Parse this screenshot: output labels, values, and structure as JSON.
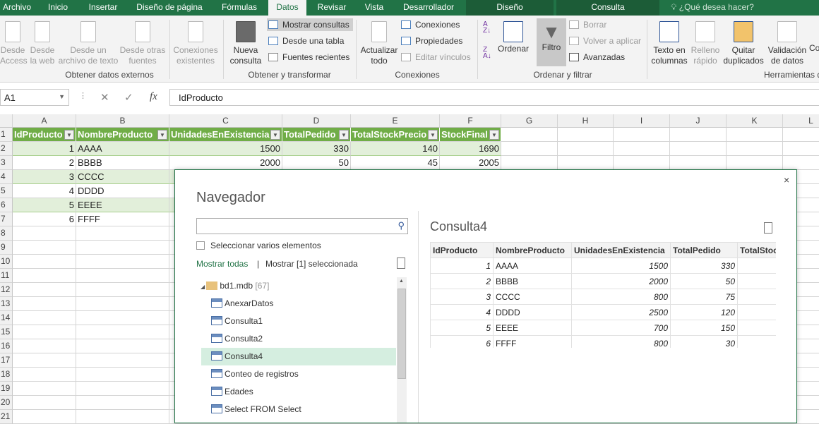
{
  "tabs": [
    "Archivo",
    "Inicio",
    "Insertar",
    "Diseño de página",
    "Fórmulas",
    "Datos",
    "Revisar",
    "Vista",
    "Desarrollador",
    "Diseño",
    "Consulta"
  ],
  "tell_me": "¿Qué desea hacer?",
  "ribbon": {
    "get_external": {
      "label": "Obtener datos externos",
      "access": "Desde Access",
      "web": "Desde la web",
      "text": "Desde un archivo de texto",
      "other": "Desde otras fuentes",
      "existing": "Conexiones existentes"
    },
    "transform": {
      "label": "Obtener y transformar",
      "new_query": "Nueva consulta",
      "show_queries": "Mostrar consultas",
      "from_table": "Desde una tabla",
      "recent": "Fuentes recientes"
    },
    "connections": {
      "label": "Conexiones",
      "refresh": "Actualizar todo",
      "connections": "Conexiones",
      "properties": "Propiedades",
      "edit_links": "Editar vínculos"
    },
    "sort_filter": {
      "label": "Ordenar y filtrar",
      "sort": "Ordenar",
      "filter": "Filtro",
      "clear": "Borrar",
      "reapply": "Volver a aplicar",
      "advanced": "Avanzadas"
    },
    "tools": {
      "label": "Herramientas d",
      "text_to_cols": "Texto en columnas",
      "flash_fill": "Relleno rápido",
      "remove_dup": "Quitar duplicados",
      "validation": "Validación de datos",
      "more": "Co"
    }
  },
  "formula_bar": {
    "name_box": "A1",
    "formula": "IdProducto"
  },
  "columns": [
    "A",
    "B",
    "C",
    "D",
    "E",
    "F",
    "G",
    "H",
    "I",
    "J",
    "K",
    "L"
  ],
  "rows": [
    "1",
    "2",
    "3",
    "4",
    "5",
    "6",
    "7",
    "8",
    "9",
    "10",
    "11",
    "12",
    "13",
    "14",
    "15",
    "16",
    "17",
    "18",
    "19",
    "20",
    "21"
  ],
  "sheet": {
    "headers": [
      "IdProducto",
      "NombreProducto",
      "UnidadesEnExistencia",
      "TotalPedido",
      "TotalStockPrecio",
      "StockFinal"
    ],
    "data": [
      [
        "1",
        "AAAA",
        "1500",
        "330",
        "140",
        "1690"
      ],
      [
        "2",
        "BBBB",
        "2000",
        "50",
        "45",
        "2005"
      ],
      [
        "3",
        "CCCC",
        "",
        "",
        "",
        ""
      ],
      [
        "4",
        "DDDD",
        "",
        "",
        "",
        ""
      ],
      [
        "5",
        "EEEE",
        "",
        "",
        "",
        ""
      ],
      [
        "6",
        "FFFF",
        "",
        "",
        "",
        ""
      ]
    ]
  },
  "navigator": {
    "title": "Navegador",
    "search_placeholder": "",
    "multi_select": "Seleccionar varios elementos",
    "show_all": "Mostrar todas",
    "sep": "|",
    "show_selected": "Mostrar [1] seleccionada",
    "root": "bd1.mdb",
    "root_count": "[67]",
    "items": [
      "AnexarDatos",
      "Consulta1",
      "Consulta2",
      "Consulta4",
      "Conteo de registros",
      "Edades",
      "Select FROM Select"
    ],
    "selected": "Consulta4",
    "preview_title": "Consulta4",
    "preview_headers": [
      "IdProducto",
      "NombreProducto",
      "UnidadesEnExistencia",
      "TotalPedido",
      "TotalStock"
    ],
    "preview_rows": [
      [
        "1",
        "AAAA",
        "1500",
        "330",
        ""
      ],
      [
        "2",
        "BBBB",
        "2000",
        "50",
        ""
      ],
      [
        "3",
        "CCCC",
        "800",
        "75",
        ""
      ],
      [
        "4",
        "DDDD",
        "2500",
        "120",
        ""
      ],
      [
        "5",
        "EEEE",
        "700",
        "150",
        ""
      ],
      [
        "6",
        "FFFF",
        "800",
        "30",
        ""
      ]
    ]
  },
  "colors": {
    "accent": "#217346",
    "table_header": "#70ad47",
    "band": "#e2efda",
    "selected": "#d5eee0"
  }
}
